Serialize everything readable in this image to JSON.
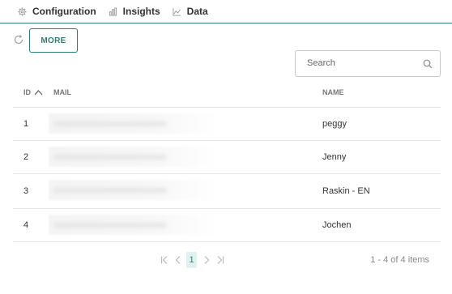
{
  "tabs": [
    {
      "label": "Configuration",
      "icon": "gear-icon"
    },
    {
      "label": "Insights",
      "icon": "bar-chart-icon"
    },
    {
      "label": "Data",
      "icon": "area-chart-icon"
    }
  ],
  "toolbar": {
    "more_label": "MORE",
    "refresh_icon": "refresh-icon"
  },
  "search": {
    "placeholder": "Search",
    "value": ""
  },
  "table": {
    "columns": {
      "id": "ID",
      "mail": "MAIL",
      "name": "NAME"
    },
    "sort": {
      "column": "ID",
      "direction": "ascending"
    },
    "rows": [
      {
        "id": "1",
        "name": "peggy"
      },
      {
        "id": "2",
        "name": "Jenny"
      },
      {
        "id": "3",
        "name": "Raskin - EN"
      },
      {
        "id": "4",
        "name": "Jochen"
      }
    ]
  },
  "pagination": {
    "current_page": "1",
    "summary": "1 - 4 of 4 items"
  },
  "colors": {
    "accent": "#2f7d74",
    "current_page_bg": "#e1f1ef"
  }
}
